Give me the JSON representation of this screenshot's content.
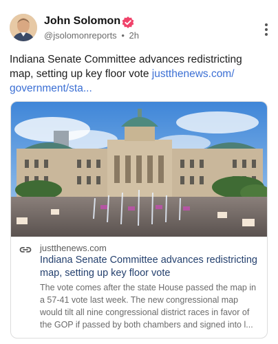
{
  "post": {
    "author_name": "John Solomon",
    "handle": "@jsolomonreports",
    "separator": "•",
    "time": "2h",
    "text": "Indiana Senate Committee advances redistricting map, setting up key floor vote",
    "link_text": "justthenews.com/​government/sta..."
  },
  "card": {
    "domain": "justthenews.com",
    "title": "Indiana Senate Committee advances redistricting map, setting up key floor vote",
    "description": "The vote comes after the state House passed the map in a 57-41 vote last week. The new congressional map would tilt all nine congressional district races in favor of the GOP if passed by both chambers and signed into l..."
  },
  "colors": {
    "verified_badge": "#f0436a",
    "link": "#3b6fd4",
    "card_title": "#24406e"
  },
  "icons": {
    "verified": "verified-badge-icon",
    "more": "more-vertical-icon",
    "link": "link-icon"
  }
}
